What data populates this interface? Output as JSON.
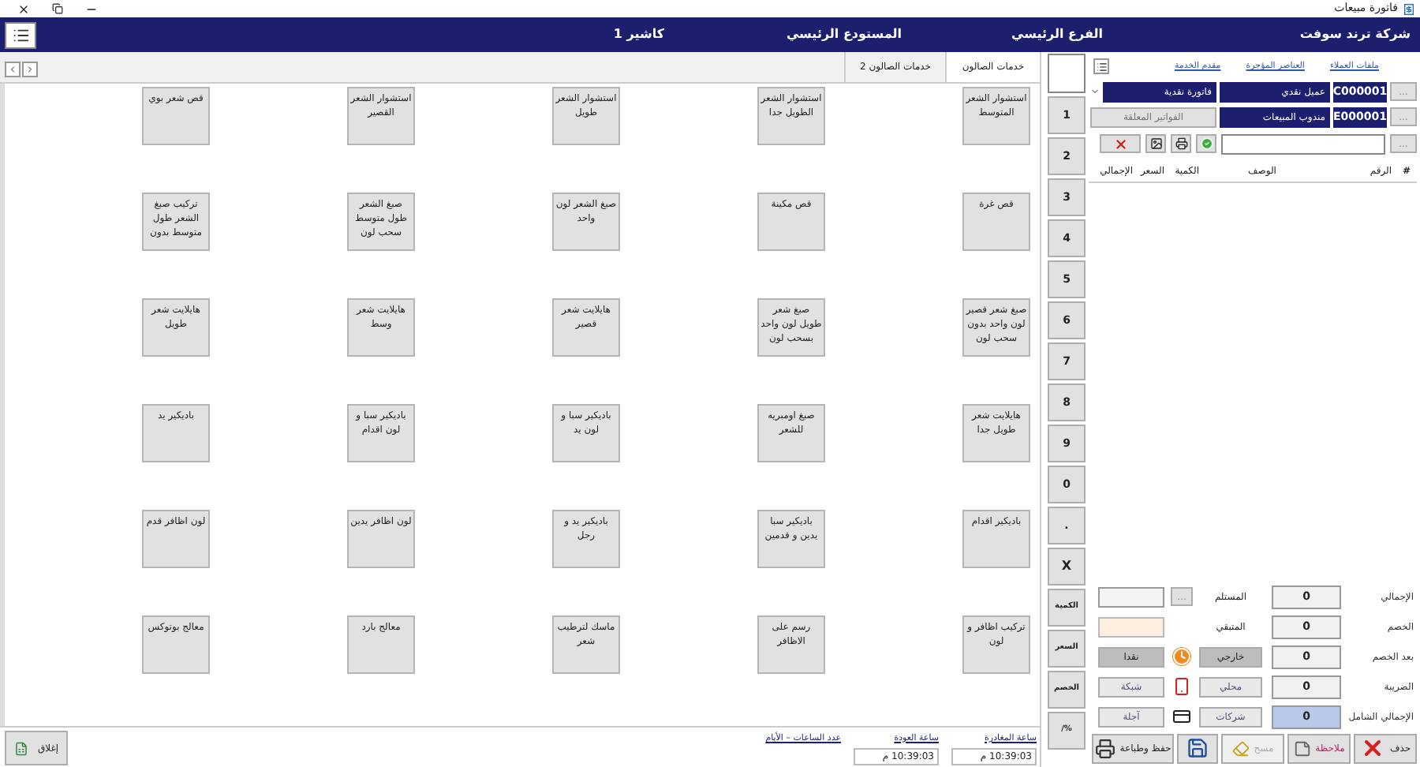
{
  "window": {
    "title": "فاتورة مبيعات"
  },
  "header": {
    "company": "شركة ترند سوفت",
    "branch": "الفرع الرئيسي",
    "warehouse": "المستودع الرئيسي",
    "cashier": "كاشير 1"
  },
  "category_tabs": [
    {
      "label": "خدمات الصالون",
      "selected": true
    },
    {
      "label": "خدمات الصالون 2",
      "selected": false
    }
  ],
  "products": [
    "استشوار الشعر المتوسط",
    "استشوار الشعر الطويل جدا",
    "استشوار الشعر طويل",
    "استشوار الشعر القصير",
    "قص شعر بوي",
    "قص غرة",
    "قص مكينة",
    "صبغ الشعر لون واحد",
    "صبغ الشعر طول متوسط سحب لون",
    "تركيب صبغ الشعر طول متوسط بدون",
    "صبغ شعر قصير لون واحد بدون سحب لون",
    "صبغ شعر طويل لون واحد بسحب لون",
    "هايلايت شعر قصير",
    "هايلايت شعر وسط",
    "هايلايت شعر طويل",
    "هايلايت شعر طويل جدا",
    "صبغ اومبريه للشعر",
    "باديكير سبا و لون يد",
    "باديكير سبا و لون اقدام",
    "باديكير يد",
    "باديكير اقدام",
    "باديكير سبا يدين و قدمين",
    "باديكير يد و رجل",
    "لون اظافر يدين",
    "لون اظافر قدم",
    "تركيب اظافر و لون",
    "رسم على الاظافر",
    "ماسك لترطيب شعر",
    "معالج بارد",
    "معالج بوتوكس"
  ],
  "keypad": [
    {
      "label": "1",
      "kind": "digit"
    },
    {
      "label": "2",
      "kind": "digit"
    },
    {
      "label": "3",
      "kind": "digit"
    },
    {
      "label": "4",
      "kind": "digit"
    },
    {
      "label": "5",
      "kind": "digit"
    },
    {
      "label": "6",
      "kind": "digit"
    },
    {
      "label": "7",
      "kind": "digit"
    },
    {
      "label": "8",
      "kind": "digit"
    },
    {
      "label": "9",
      "kind": "digit"
    },
    {
      "label": "0",
      "kind": "digit"
    },
    {
      "label": ".",
      "kind": "digit"
    },
    {
      "label": "X",
      "kind": "clear"
    },
    {
      "label": "الكمية",
      "kind": "function"
    },
    {
      "label": "السعر",
      "kind": "function"
    },
    {
      "label": "الخصم",
      "kind": "function"
    },
    {
      "label": "%/",
      "kind": "function"
    }
  ],
  "customer_links": [
    "ملفات العملاء",
    "العناصر المؤجرة",
    "مقدم الخدمة"
  ],
  "browse_buttons": [
    "...",
    "...",
    "..."
  ],
  "customer": {
    "code": "C000001",
    "name": "عميل نقدي",
    "invoice_type": "فاتورة نقدية"
  },
  "salesman": {
    "code": "E000001",
    "name": "مندوب المبيعات"
  },
  "held_invoices_button": "الفواتير المعلقة",
  "table": {
    "columns": [
      "#",
      "الرقم",
      "الوصف",
      "الكمية",
      "السعر",
      "الإجمالي"
    ]
  },
  "totals": [
    {
      "label": "الإجمالي",
      "value": "0",
      "selected": false
    },
    {
      "label": "الخصم",
      "value": "0",
      "selected": false
    },
    {
      "label": "بعد الخصم",
      "value": "0",
      "selected": false
    },
    {
      "label": "الضريبة",
      "value": "0",
      "selected": false
    },
    {
      "label": "الإجمالي الشامل",
      "value": "0",
      "selected": true
    }
  ],
  "payment": {
    "browse_button": "...",
    "received_label": "المستلم",
    "remaining_label": "المتبقي"
  },
  "payment_rows": [
    {
      "order_type": "خارجي",
      "order_selected": true,
      "kind": "clock",
      "method": "نقدا",
      "method_selected": true
    },
    {
      "order_type": "محلي",
      "order_selected": false,
      "kind": "phone",
      "method": "شبكة",
      "method_selected": false
    },
    {
      "order_type": "شركات",
      "order_selected": false,
      "kind": "card",
      "method": "آجلة",
      "method_selected": false
    }
  ],
  "actions": [
    {
      "label": "حذف",
      "kind": "delete",
      "disabled": false
    },
    {
      "label": "ملاحظة",
      "kind": "note",
      "disabled": false
    },
    {
      "label": "مسح",
      "kind": "clear",
      "disabled": true
    },
    {
      "kind": "save",
      "disabled": false
    },
    {
      "label": "حفظ وطباعة",
      "kind": "print",
      "disabled": false
    }
  ],
  "footer": {
    "close_button": "إغلاق",
    "departure": {
      "label": "ساعة المغادرة",
      "value": "10:39:03 م"
    },
    "return": {
      "label": "ساعة العودة",
      "value": "10:39:03 م"
    },
    "duration_label": "عدد الساعات – الأيام"
  }
}
